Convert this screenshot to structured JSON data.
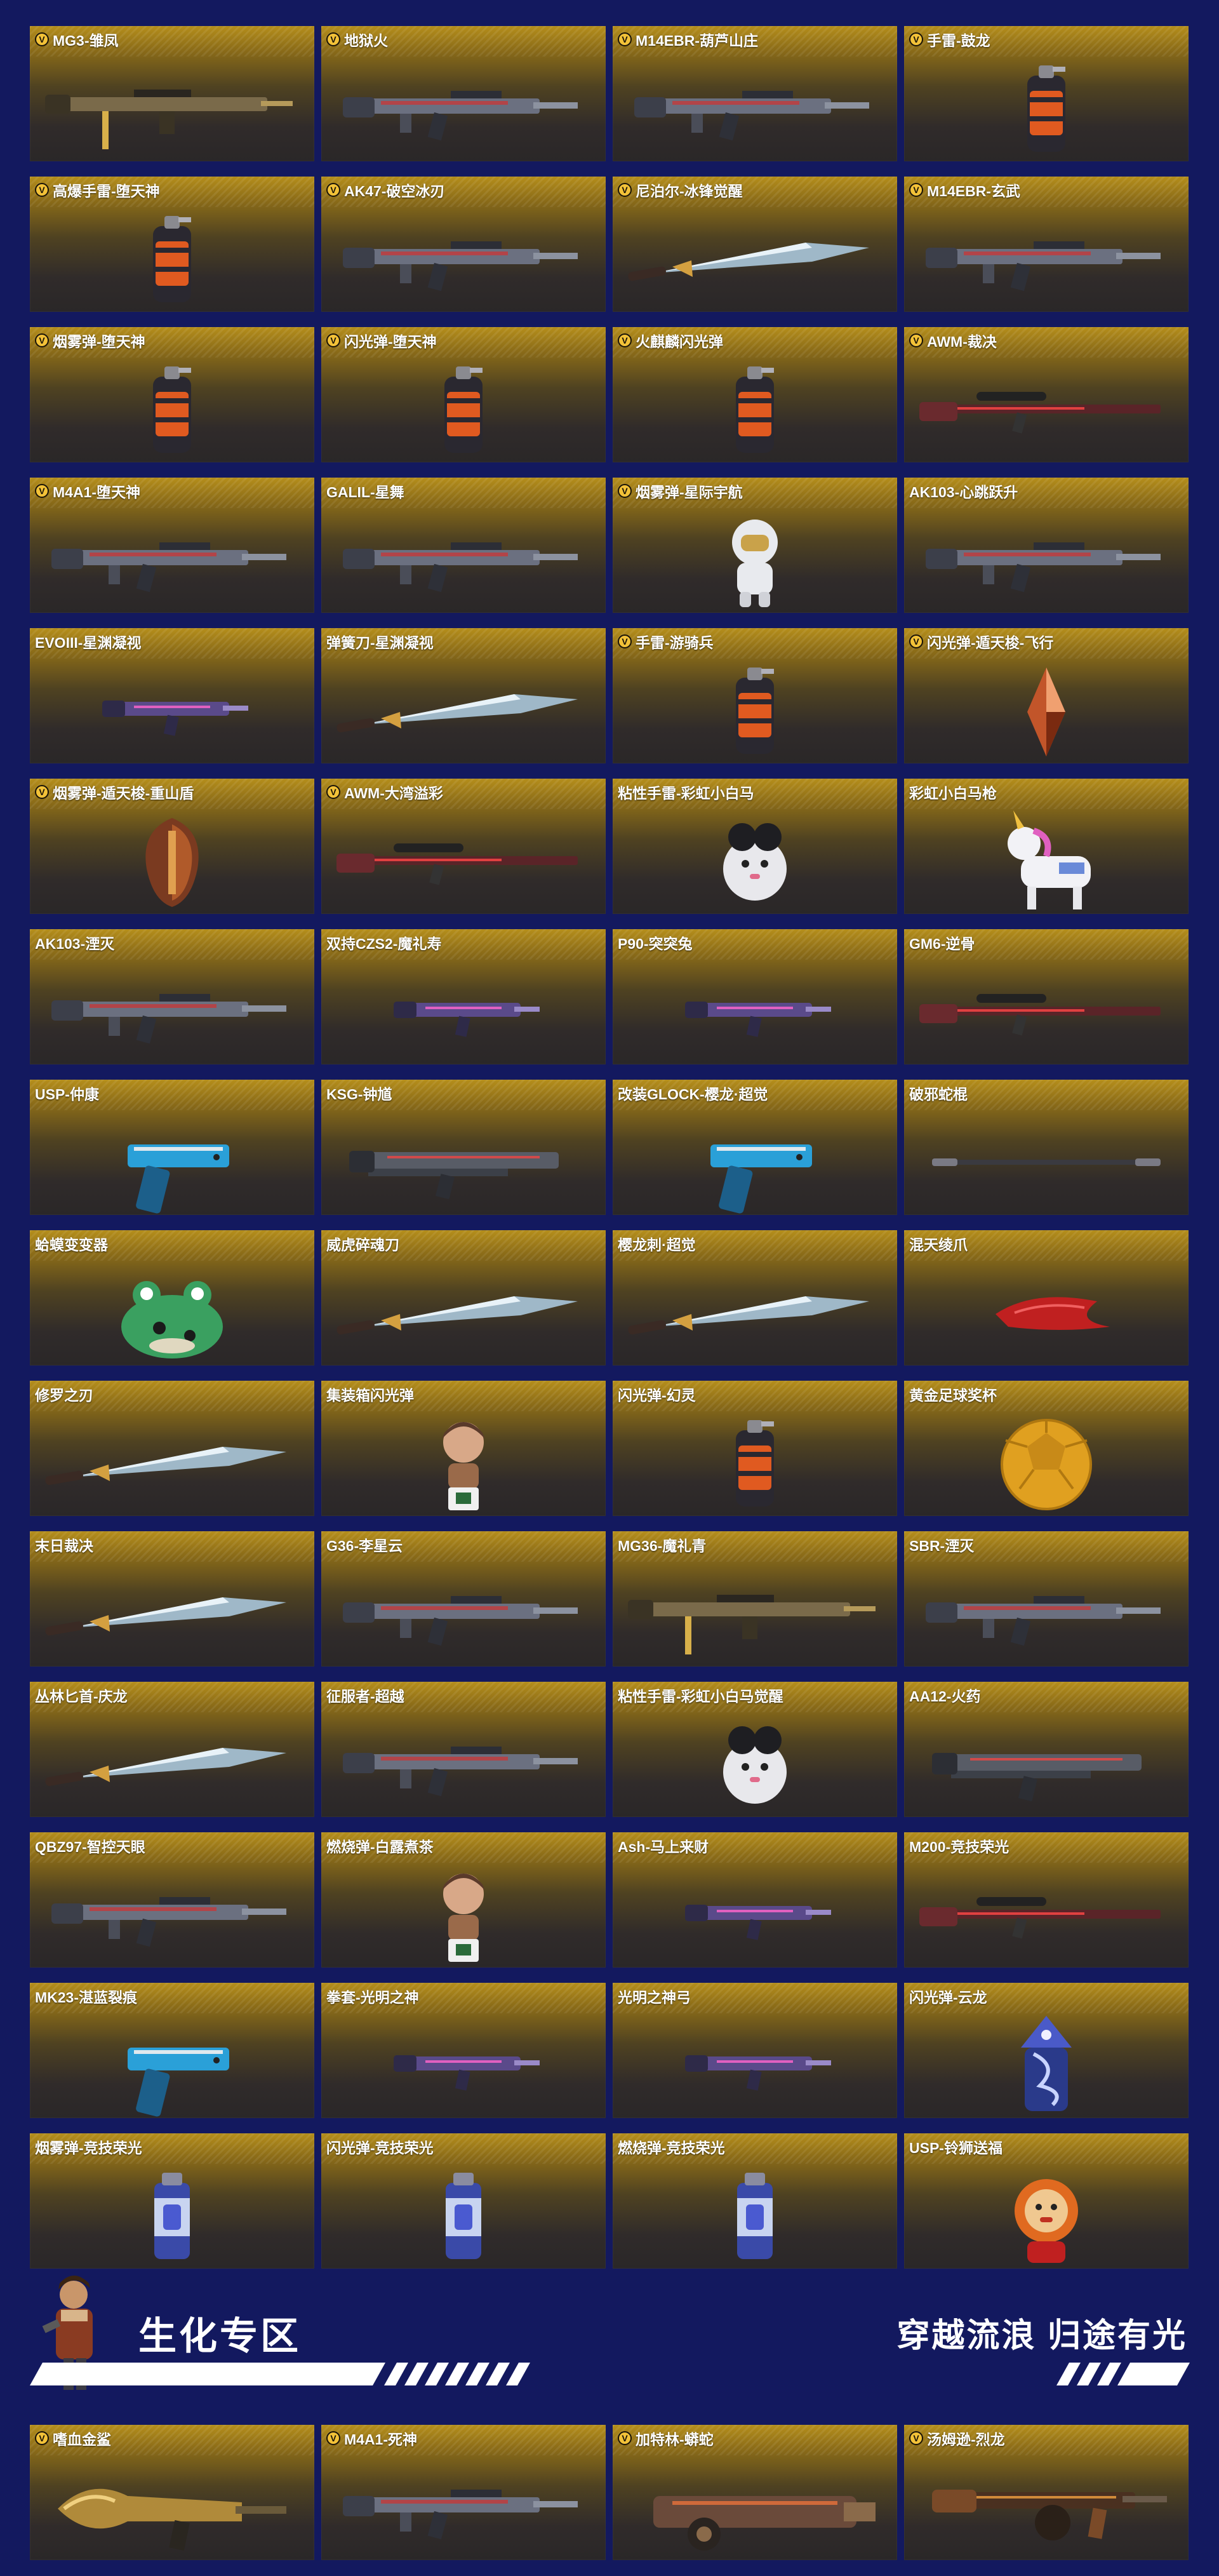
{
  "colors": {
    "page_bg": "#13195f",
    "card_gold": "#b58e1b",
    "card_dark": "#2a2728",
    "vip_badge": "#f3c238"
  },
  "items": [
    {
      "name": "MG3-雏凤",
      "vip": true,
      "icon": "machine-gun-icon"
    },
    {
      "name": "地狱火",
      "vip": true,
      "icon": "rifle-icon"
    },
    {
      "name": "M14EBR-葫芦山庄",
      "vip": true,
      "icon": "rifle-icon"
    },
    {
      "name": "手雷-鼓龙",
      "vip": true,
      "icon": "grenade-icon"
    },
    {
      "name": "高爆手雷-堕天神",
      "vip": true,
      "icon": "grenade-icon"
    },
    {
      "name": "AK47-破空冰刃",
      "vip": true,
      "icon": "rifle-icon"
    },
    {
      "name": "尼泊尔-冰锋觉醒",
      "vip": true,
      "icon": "blade-icon"
    },
    {
      "name": "M14EBR-玄武",
      "vip": true,
      "icon": "rifle-icon"
    },
    {
      "name": "烟雾弹-堕天神",
      "vip": true,
      "icon": "grenade-icon"
    },
    {
      "name": "闪光弹-堕天神",
      "vip": true,
      "icon": "grenade-icon"
    },
    {
      "name": "火麒麟闪光弹",
      "vip": true,
      "icon": "grenade-icon"
    },
    {
      "name": "AWM-裁决",
      "vip": true,
      "icon": "sniper-icon"
    },
    {
      "name": "M4A1-堕天神",
      "vip": true,
      "icon": "rifle-icon"
    },
    {
      "name": "GALIL-星舞",
      "vip": false,
      "icon": "rifle-icon"
    },
    {
      "name": "烟雾弹-星际宇航",
      "vip": true,
      "icon": "astronaut-icon"
    },
    {
      "name": "AK103-心跳跃升",
      "vip": false,
      "icon": "rifle-icon"
    },
    {
      "name": "EVOIII-星渊凝视",
      "vip": false,
      "icon": "smg-icon"
    },
    {
      "name": "弹簧刀-星渊凝视",
      "vip": false,
      "icon": "blade-icon"
    },
    {
      "name": "手雷-游骑兵",
      "vip": true,
      "icon": "grenade-icon"
    },
    {
      "name": "闪光弹-遁天梭-飞行",
      "vip": true,
      "icon": "crystal-icon"
    },
    {
      "name": "烟雾弹-遁天梭-重山盾",
      "vip": true,
      "icon": "shield-icon"
    },
    {
      "name": "AWM-大湾溢彩",
      "vip": true,
      "icon": "sniper-icon"
    },
    {
      "name": "粘性手雷-彩虹小白马",
      "vip": false,
      "icon": "plush-icon"
    },
    {
      "name": "彩虹小白马枪",
      "vip": false,
      "icon": "unicorn-icon"
    },
    {
      "name": "AK103-湮灭",
      "vip": false,
      "icon": "rifle-icon"
    },
    {
      "name": "双持CZS2-魔礼寿",
      "vip": false,
      "icon": "smg-icon"
    },
    {
      "name": "P90-突突兔",
      "vip": false,
      "icon": "smg-icon"
    },
    {
      "name": "GM6-逆骨",
      "vip": false,
      "icon": "sniper-icon"
    },
    {
      "name": "USP-仲康",
      "vip": false,
      "icon": "pistol-icon"
    },
    {
      "name": "KSG-钟馗",
      "vip": false,
      "icon": "shotgun-icon"
    },
    {
      "name": "改装GLOCK-樱龙·超觉",
      "vip": false,
      "icon": "pistol-icon"
    },
    {
      "name": "破邪蛇棍",
      "vip": false,
      "icon": "staff-icon"
    },
    {
      "name": "蛤蟆变变器",
      "vip": false,
      "icon": "frog-icon"
    },
    {
      "name": "威虎碎魂刀",
      "vip": false,
      "icon": "blade-icon"
    },
    {
      "name": "樱龙刺·超觉",
      "vip": false,
      "icon": "blade-icon"
    },
    {
      "name": "混天绫爪",
      "vip": false,
      "icon": "claw-icon"
    },
    {
      "name": "修罗之刃",
      "vip": false,
      "icon": "blade-icon"
    },
    {
      "name": "集装箱闪光弹",
      "vip": false,
      "icon": "figure-icon"
    },
    {
      "name": "闪光弹-幻灵",
      "vip": false,
      "icon": "grenade-icon"
    },
    {
      "name": "黄金足球奖杯",
      "vip": false,
      "icon": "ball-icon"
    },
    {
      "name": "末日裁决",
      "vip": false,
      "icon": "blade-icon"
    },
    {
      "name": "G36-李星云",
      "vip": false,
      "icon": "rifle-icon"
    },
    {
      "name": "MG36-魔礼青",
      "vip": false,
      "icon": "machine-gun-icon"
    },
    {
      "name": "SBR-湮灭",
      "vip": false,
      "icon": "rifle-icon"
    },
    {
      "name": "丛林匕首-庆龙",
      "vip": false,
      "icon": "blade-icon"
    },
    {
      "name": "征服者-超越",
      "vip": false,
      "icon": "rifle-icon"
    },
    {
      "name": "粘性手雷-彩虹小白马觉醒",
      "vip": false,
      "icon": "plush-icon"
    },
    {
      "name": "AA12-火药",
      "vip": false,
      "icon": "shotgun-icon"
    },
    {
      "name": "QBZ97-智控天眼",
      "vip": false,
      "icon": "rifle-icon"
    },
    {
      "name": "燃烧弹-白露煮茶",
      "vip": false,
      "icon": "figure-icon"
    },
    {
      "name": "Ash-马上来财",
      "vip": false,
      "icon": "smg-icon"
    },
    {
      "name": "M200-竞技荣光",
      "vip": false,
      "icon": "sniper-icon"
    },
    {
      "name": "MK23-湛蓝裂痕",
      "vip": false,
      "icon": "pistol-icon"
    },
    {
      "name": "拳套-光明之神",
      "vip": false,
      "icon": "smg-icon"
    },
    {
      "name": "光明之神弓",
      "vip": false,
      "icon": "smg-icon"
    },
    {
      "name": "闪光弹-云龙",
      "vip": false,
      "icon": "dragon-icon"
    },
    {
      "name": "烟雾弹-竞技荣光",
      "vip": false,
      "icon": "can-icon"
    },
    {
      "name": "闪光弹-竞技荣光",
      "vip": false,
      "icon": "can-icon"
    },
    {
      "name": "燃烧弹-竞技荣光",
      "vip": false,
      "icon": "can-icon"
    },
    {
      "name": "USP-铃狮送福",
      "vip": false,
      "icon": "lion-icon"
    }
  ],
  "banner": {
    "title": "生化专区",
    "slogan": "穿越流浪 归途有光",
    "avatar_icon": "soldier-avatar-icon"
  },
  "zombie_items": [
    {
      "name": "嗜血金鲨",
      "vip": true,
      "icon": "claw-gun-icon"
    },
    {
      "name": "M4A1-死神",
      "vip": true,
      "icon": "rifle-icon"
    },
    {
      "name": "加特林-蟒蛇",
      "vip": true,
      "icon": "gatling-icon"
    },
    {
      "name": "汤姆逊-烈龙",
      "vip": true,
      "icon": "tommy-gun-icon"
    }
  ],
  "vip_badge_text": "V"
}
